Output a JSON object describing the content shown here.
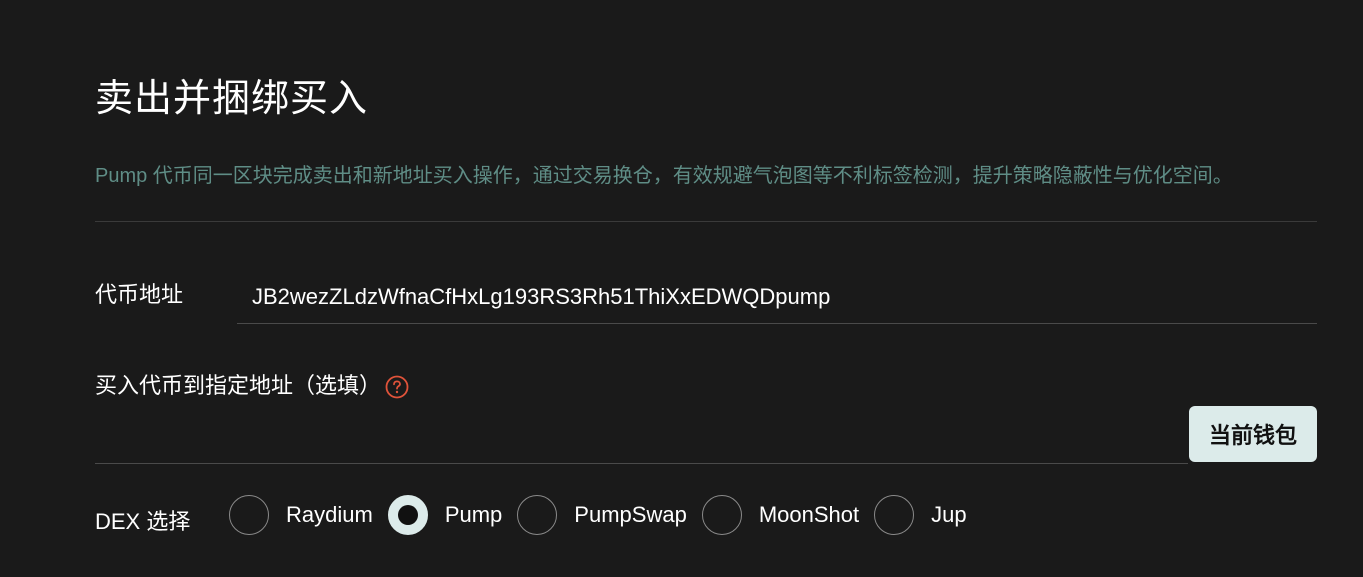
{
  "header": {
    "title": "卖出并捆绑买入",
    "description": "Pump 代币同一区块完成卖出和新地址买入操作，通过交易换仓，有效规避气泡图等不利标签检测，提升策略隐蔽性与优化空间。"
  },
  "form": {
    "token_address": {
      "label": "代币地址",
      "value": "JB2wezZLdzWfnaCfHxLg193RS3Rh51ThiXxEDWQDpump"
    },
    "buy_address": {
      "label": "买入代币到指定地址（选填）",
      "value": "",
      "help_icon": "question-circle-icon",
      "wallet_button": "当前钱包"
    },
    "dex": {
      "label": "DEX 选择",
      "selected": "Pump",
      "options": [
        "Raydium",
        "Pump",
        "PumpSwap",
        "MoonShot",
        "Jup"
      ]
    }
  },
  "colors": {
    "background": "#1a1a1a",
    "description": "#5f8d86",
    "accent": "#dcebea",
    "help_icon": "#e0533a"
  }
}
